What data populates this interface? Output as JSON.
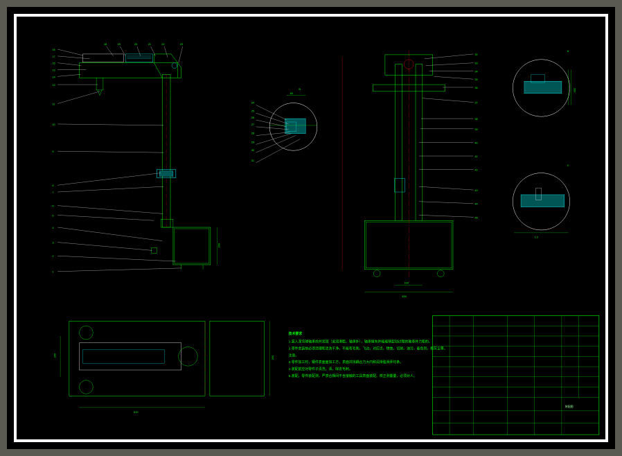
{
  "callouts_left": [
    "16",
    "17",
    "15",
    "13",
    "14",
    "12",
    "11",
    "10",
    "9",
    "8",
    "7",
    "6",
    "5",
    "4",
    "3",
    "2",
    "1"
  ],
  "callouts_top_upper": [
    "18",
    "19",
    "20",
    "21",
    "22",
    "23"
  ],
  "callouts_top_right": [
    "24",
    "25",
    "26",
    "27",
    "28",
    "29",
    "30",
    "31"
  ],
  "callouts_view2_right": [
    "32",
    "33",
    "34",
    "35",
    "36",
    "37",
    "38",
    "39",
    "40",
    "41",
    "42",
    "43",
    "44",
    "45"
  ],
  "dimensions": {
    "height_A": "200",
    "width_A": "510",
    "height_B": "200",
    "height_C": "60",
    "width_gap": "130",
    "width_base": "400",
    "detail_B": "1:2",
    "detail_C": "1:2"
  },
  "detail_labels": {
    "B": "B",
    "C": "C"
  },
  "notes_title": "技术要求",
  "notes": [
    "1.装入深沟球轴承前并润润（含润滑脂，轴承外），轴承填充并能能够起动过程的轴承并力矩的。",
    "2.零件会装前必须清理和清洗干净，不能有毛刺，飞边，对应点，锈蚀，切屑，油污，着色剂，和灰尘等。",
    "注意。",
    "3.零件加工时，钢件表面面加工方，表面并找耦合力大円和润滑脂滑弄均条。",
    "4.装配前应对零件子清洗，清，除去毛刺。",
    "5.装配，零件装配测，严禁合相间不含接触的工具表面装配。校正测量量，必须对人。"
  ],
  "title_block": {
    "project": "装配图",
    "rev": "—",
    "scale": "—",
    "sheet": "—",
    "no": "—"
  }
}
